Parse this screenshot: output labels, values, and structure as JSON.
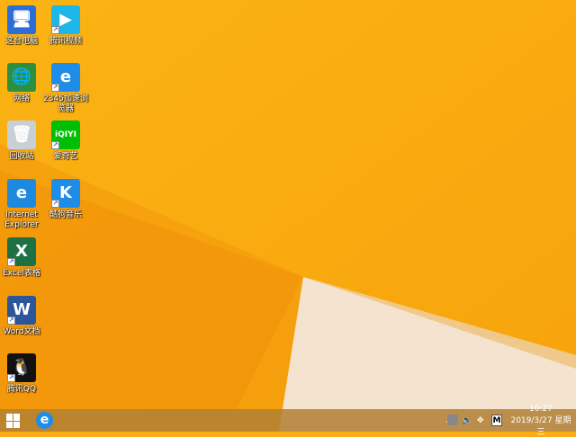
{
  "desktop": {
    "icons": [
      {
        "label": "这台电脑",
        "icon": "computer-icon",
        "color": "#2b6fd6"
      },
      {
        "label": "腾讯视频",
        "icon": "tencent-video-icon",
        "color": "#1fb6e8"
      },
      {
        "label": "网络",
        "icon": "network-icon",
        "color": "#2e8f3e"
      },
      {
        "label": "2345加速浏览器",
        "icon": "browser-2345-icon",
        "color": "#1e8de8"
      },
      {
        "label": "回收站",
        "icon": "recycle-bin-icon",
        "color": "#c9cfd6"
      },
      {
        "label": "爱奇艺",
        "icon": "iqiyi-icon",
        "color": "#00be06"
      },
      {
        "label": "Internet Explorer",
        "icon": "internet-explorer-icon",
        "color": "#1d8ae0"
      },
      {
        "label": "酷狗音乐",
        "icon": "kugou-icon",
        "color": "#1e8de8"
      },
      {
        "label": "Excel表格",
        "icon": "excel-icon",
        "color": "#1e7145"
      },
      {
        "label": "Word文档",
        "icon": "word-icon",
        "color": "#2b579a"
      },
      {
        "label": "腾讯QQ",
        "icon": "qq-icon",
        "color": "#111111"
      }
    ]
  },
  "taskbar": {
    "start": "windows-start-icon",
    "pinned": [
      "internet-explorer-icon"
    ],
    "tray": {
      "chevron": "▲",
      "ime": "M",
      "time": "10:27",
      "date": "2019/3/27 星期三"
    }
  }
}
